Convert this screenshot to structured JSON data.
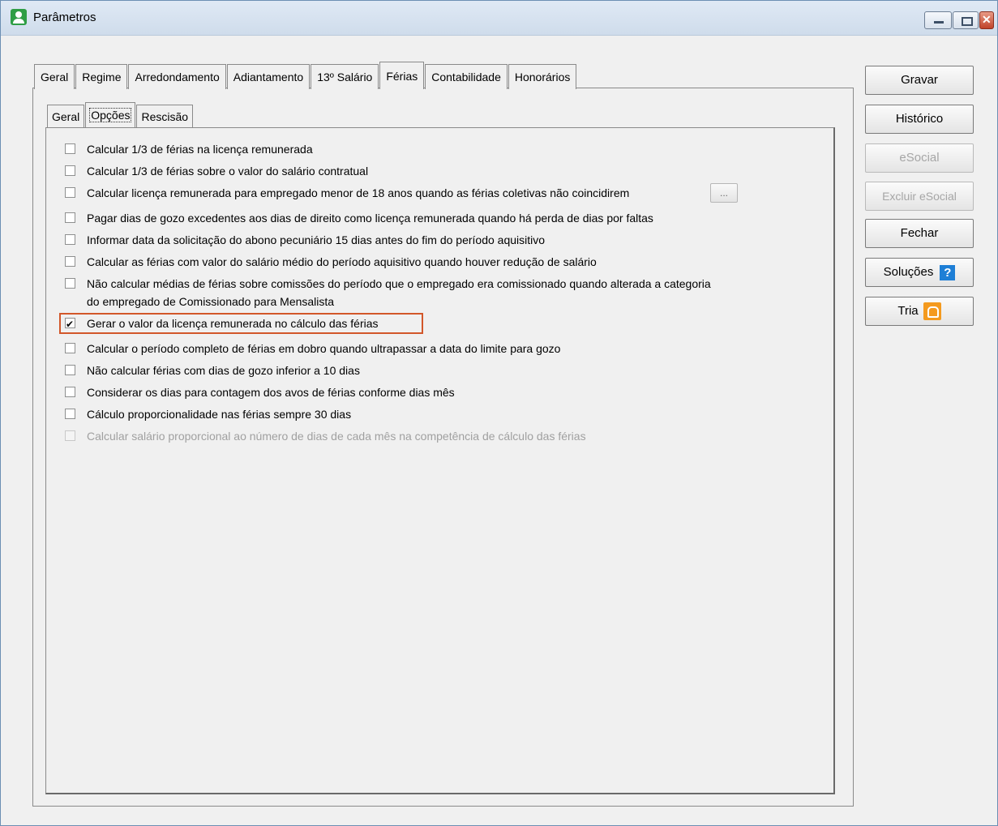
{
  "window": {
    "title": "Parâmetros"
  },
  "tabs": [
    "Geral",
    "Regime",
    "Arredondamento",
    "Adiantamento",
    "13º Salário",
    "Férias",
    "Contabilidade",
    "Honorários"
  ],
  "subtabs": [
    "Geral",
    "Opções",
    "Rescisão"
  ],
  "options": [
    {
      "label": "Calcular 1/3 de férias na licença remunerada",
      "checked": false
    },
    {
      "label": "Calcular 1/3 de férias sobre o valor do salário contratual",
      "checked": false
    },
    {
      "label": "Calcular licença remunerada para empregado menor de 18 anos quando as férias coletivas não coincidirem",
      "checked": false
    },
    {
      "label": "Pagar dias de gozo excedentes aos dias de direito como licença remunerada quando há perda de dias por faltas",
      "checked": false
    },
    {
      "label": "Informar data da solicitação do abono pecuniário 15 dias antes do fim do período aquisitivo",
      "checked": false
    },
    {
      "label": "Calcular as férias com valor do salário médio do período aquisitivo quando houver redução de salário",
      "checked": false
    },
    {
      "label": "Não calcular médias de férias sobre comissões do período que o empregado era comissionado quando alterada a categoria",
      "label2": "do empregado de Comissionado para Mensalista",
      "checked": false
    },
    {
      "label": "Gerar o valor da licença remunerada no cálculo das férias",
      "checked": true
    },
    {
      "label": "Calcular o período completo de férias em dobro quando ultrapassar a data do limite para gozo",
      "checked": false
    },
    {
      "label": "Não calcular férias com dias de gozo inferior a 10 dias",
      "checked": false
    },
    {
      "label": "Considerar os dias para contagem dos avos de férias conforme dias mês",
      "checked": false
    },
    {
      "label": "Cálculo proporcionalidade nas férias sempre 30 dias",
      "checked": false
    },
    {
      "label": "Calcular salário proporcional ao número de dias de cada mês na competência de cálculo das férias",
      "checked": false,
      "disabled": true
    }
  ],
  "ellipsis_label": "...",
  "buttons": {
    "gravar": "Gravar",
    "historico": "Histórico",
    "esocial": "eSocial",
    "excluir_esocial": "Excluir eSocial",
    "fechar": "Fechar",
    "solucoes": "Soluções",
    "help_glyph": "?",
    "tria": "Tria"
  }
}
